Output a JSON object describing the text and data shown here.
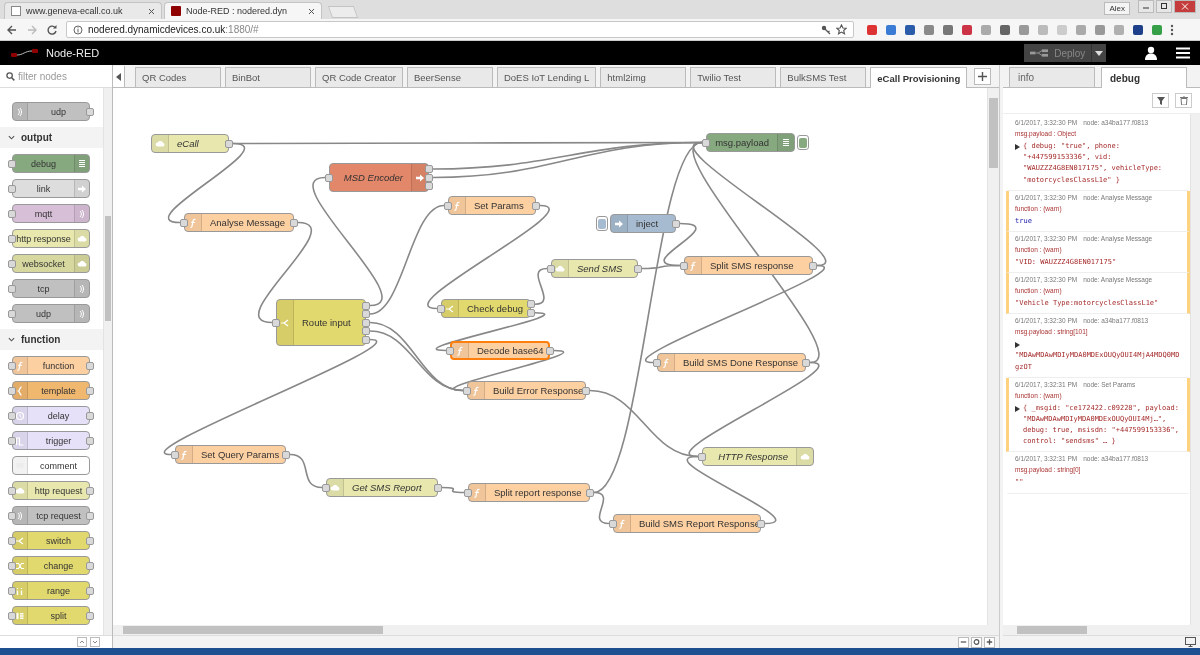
{
  "browser": {
    "tabs": [
      {
        "title": "www.geneva-ecall.co.uk",
        "selected": false
      },
      {
        "title": "Node-RED : nodered.dyn",
        "selected": true
      }
    ],
    "profile": "Alex",
    "address": {
      "host": "nodered.dynamicdevices.co.uk",
      "path": ":1880/#"
    }
  },
  "header": {
    "title": "Node-RED",
    "deploy": {
      "label": "Deploy",
      "disabled": true
    }
  },
  "palette": {
    "placeholder": "filter nodes",
    "top_nodes": [
      {
        "label": "udp",
        "kind": "udp-in"
      }
    ],
    "categories": [
      {
        "title": "output",
        "expanded": true,
        "nodes": [
          {
            "label": "debug",
            "kind": "debug"
          },
          {
            "label": "link",
            "kind": "link"
          },
          {
            "label": "mqtt",
            "kind": "mqtt"
          },
          {
            "label": "http response",
            "kind": "http-out"
          },
          {
            "label": "websocket",
            "kind": "websocket"
          },
          {
            "label": "tcp",
            "kind": "tcp-out"
          },
          {
            "label": "udp",
            "kind": "tcp-out"
          }
        ]
      },
      {
        "title": "function",
        "expanded": true,
        "nodes": [
          {
            "label": "function",
            "kind": "function"
          },
          {
            "label": "template",
            "kind": "template"
          },
          {
            "label": "delay",
            "kind": "delay"
          },
          {
            "label": "trigger",
            "kind": "trigger"
          },
          {
            "label": "comment",
            "kind": "comment"
          },
          {
            "label": "http request",
            "kind": "http-request"
          },
          {
            "label": "tcp request",
            "kind": "tcp-request"
          },
          {
            "label": "switch",
            "kind": "switch"
          },
          {
            "label": "change",
            "kind": "change"
          },
          {
            "label": "range",
            "kind": "range"
          },
          {
            "label": "split",
            "kind": "split"
          }
        ]
      }
    ]
  },
  "workspace_tabs": [
    {
      "label": "QR Codes",
      "selected": false
    },
    {
      "label": "BinBot",
      "selected": false
    },
    {
      "label": "QR Code Creator",
      "selected": false
    },
    {
      "label": "BeerSense",
      "selected": false
    },
    {
      "label": "DoES IoT Lending L",
      "selected": false
    },
    {
      "label": "html2img",
      "selected": false
    },
    {
      "label": "Twilio Test",
      "selected": false
    },
    {
      "label": "BulkSMS Test",
      "selected": false
    },
    {
      "label": "eCall Provisioning",
      "selected": true
    }
  ],
  "nodes": [
    {
      "label": "eCall",
      "kind": "http-in",
      "italic": true,
      "selected": false
    },
    {
      "label": "msg.payload",
      "kind": "debug",
      "italic": false,
      "selected": false
    },
    {
      "label": "MSD Encoder",
      "kind": "msd",
      "italic": true,
      "selected": false
    },
    {
      "label": "Set Params",
      "kind": "function",
      "italic": false,
      "selected": false
    },
    {
      "label": "inject",
      "kind": "inject",
      "italic": false,
      "selected": false
    },
    {
      "label": "Analyse Message",
      "kind": "function",
      "italic": false,
      "selected": false
    },
    {
      "label": "Send SMS",
      "kind": "http-request",
      "italic": true,
      "selected": false
    },
    {
      "label": "Split SMS response",
      "kind": "function",
      "italic": false,
      "selected": false
    },
    {
      "label": "Route input",
      "kind": "switch",
      "italic": false,
      "selected": false
    },
    {
      "label": "Check debug",
      "kind": "switch",
      "italic": false,
      "selected": false
    },
    {
      "label": "Decode base64",
      "kind": "function",
      "italic": false,
      "selected": true
    },
    {
      "label": "Build SMS Done Response",
      "kind": "function",
      "italic": false,
      "selected": false
    },
    {
      "label": "Build Error Response",
      "kind": "function",
      "italic": false,
      "selected": false
    },
    {
      "label": "Set Query Params",
      "kind": "function",
      "italic": false,
      "selected": false
    },
    {
      "label": "HTTP Response",
      "kind": "http-out",
      "italic": true,
      "selected": false
    },
    {
      "label": "Get SMS Report",
      "kind": "http-request",
      "italic": true,
      "selected": false
    },
    {
      "label": "Split report response",
      "kind": "function",
      "italic": false,
      "selected": false
    },
    {
      "label": "Build SMS Report Response",
      "kind": "function",
      "italic": false,
      "selected": false
    }
  ],
  "sidebar": {
    "tabs": [
      {
        "label": "info",
        "selected": false
      },
      {
        "label": "debug",
        "selected": true
      }
    ],
    "messages": [
      {
        "time": "6/1/2017, 3:32:30 PM",
        "node": "node: a34ba177.f0813",
        "topic": "msg.payload : Object",
        "kind": "object",
        "warn": false,
        "value": "{ debug: \"true\", phone: \"+447599153336\", vid: \"WAUZZZ4G8EN017175\", vehicleType: \"motorcyclesClassL1e\" }"
      },
      {
        "time": "6/1/2017, 3:32:30 PM",
        "node": "node: Analyse Message",
        "topic": "function : (warn)",
        "kind": "boolean",
        "warn": true,
        "value": "true"
      },
      {
        "time": "6/1/2017, 3:32:30 PM",
        "node": "node: Analyse Message",
        "topic": "function : (warn)",
        "kind": "string",
        "warn": true,
        "value": "\"VID: WAUZZZ4G8EN017175\""
      },
      {
        "time": "6/1/2017, 3:32:30 PM",
        "node": "node: Analyse Message",
        "topic": "function : (warn)",
        "kind": "string",
        "warn": true,
        "value": "\"Vehicle Type:motorcyclesClassL1e\""
      },
      {
        "time": "6/1/2017, 3:32:30 PM",
        "node": "node: a34ba177.f0813",
        "topic": "msg.payload : string[101]",
        "kind": "long-string",
        "warn": false,
        "value": "\"MDAwMDAwMDIyMDA0MDExOUQyOUI4MjA4MDQ0MDgzOT"
      },
      {
        "time": "6/1/2017, 3:32:31 PM",
        "node": "node: Set Params",
        "topic": "function : (warn)",
        "kind": "object",
        "warn": true,
        "value": "{ _msgid: \"ce172422.c09228\", payload: \"MDAwMDAwMDIyMDA0MDExOUQyOUI4Mj…\", debug: true, msisdn: \"+447599153336\", control: \"sendsms\" … }"
      },
      {
        "time": "6/1/2017, 3:32:31 PM",
        "node": "node: a34ba177.f0813",
        "topic": "msg.payload : string[0]",
        "kind": "string",
        "warn": false,
        "value": "\"\""
      }
    ]
  }
}
